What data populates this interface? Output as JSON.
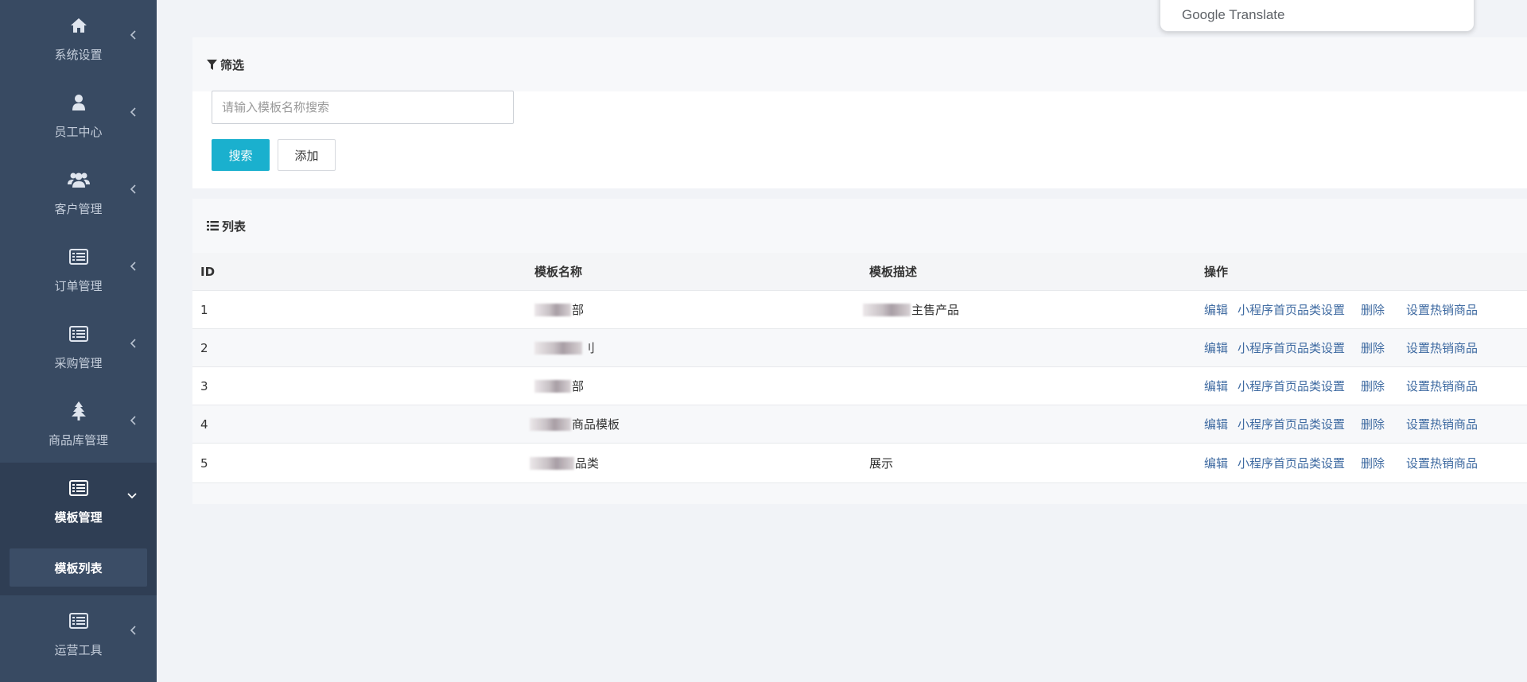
{
  "sidebar": {
    "items": [
      {
        "label": "系统设置",
        "icon": "home-icon"
      },
      {
        "label": "员工中心",
        "icon": "user-icon"
      },
      {
        "label": "客户管理",
        "icon": "users-icon"
      },
      {
        "label": "订单管理",
        "icon": "list-card-icon"
      },
      {
        "label": "采购管理",
        "icon": "list-card-icon"
      },
      {
        "label": "商品库管理",
        "icon": "tree-icon"
      },
      {
        "label": "模板管理",
        "icon": "list-card-icon",
        "expanded": true
      },
      {
        "label": "运营工具",
        "icon": "list-card-icon"
      }
    ],
    "subitems": [
      {
        "label": "模板列表",
        "active": true
      }
    ]
  },
  "filter": {
    "title": "筛选",
    "search_placeholder": "请输入模板名称搜索",
    "search_value": "",
    "search_button": "搜索",
    "add_button": "添加"
  },
  "list": {
    "title": "列表",
    "columns": [
      "ID",
      "模板名称",
      "模板描述",
      "操作"
    ],
    "rows": [
      {
        "id": "1",
        "name": "部",
        "desc": "主售产品"
      },
      {
        "id": "2",
        "name": "刂",
        "desc": ""
      },
      {
        "id": "3",
        "name": "部",
        "desc": ""
      },
      {
        "id": "4",
        "name": "商品模板",
        "desc": ""
      },
      {
        "id": "5",
        "name": "品类",
        "desc": "展示"
      }
    ],
    "actions": {
      "edit": "编辑",
      "home_category": "小程序首页品类设置",
      "delete": "删除",
      "hot_products": "设置热销商品"
    }
  },
  "translate_popup": {
    "brand": "Google",
    "product": "Translate"
  },
  "colors": {
    "sidebar_bg": "#384a62",
    "primary_button": "#1ab0ce",
    "link": "#3e6aa1"
  }
}
